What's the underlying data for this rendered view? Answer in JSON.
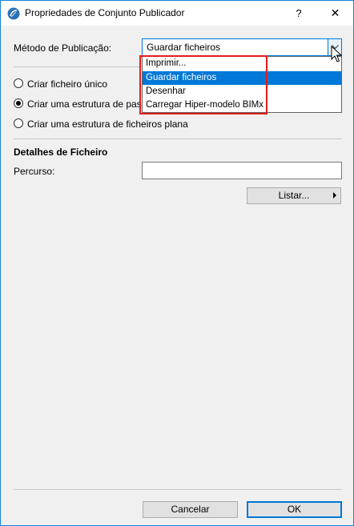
{
  "window": {
    "title": "Propriedades de Conjunto Publicador",
    "help_label": "?",
    "close_label": "✕"
  },
  "method": {
    "label": "Método de Publicação:",
    "selected": "Guardar ficheiros",
    "options": [
      "Imprimir...",
      "Guardar ficheiros",
      "Desenhar",
      "Carregar Hiper-modelo BIMx"
    ]
  },
  "structure_options": [
    {
      "label": "Criar ficheiro único",
      "checked": false
    },
    {
      "label": "Criar uma estrutura de pastas",
      "checked": true
    },
    {
      "label": "Criar uma estrutura de ficheiros plana",
      "checked": false
    }
  ],
  "file_details": {
    "heading": "Detalhes de Ficheiro",
    "path_label": "Percurso:",
    "path_value": "",
    "list_button": "Listar..."
  },
  "footer": {
    "cancel_label": "Cancelar",
    "ok_label": "OK"
  },
  "colors": {
    "accent": "#0078d7",
    "highlight": "#e41d1d"
  }
}
